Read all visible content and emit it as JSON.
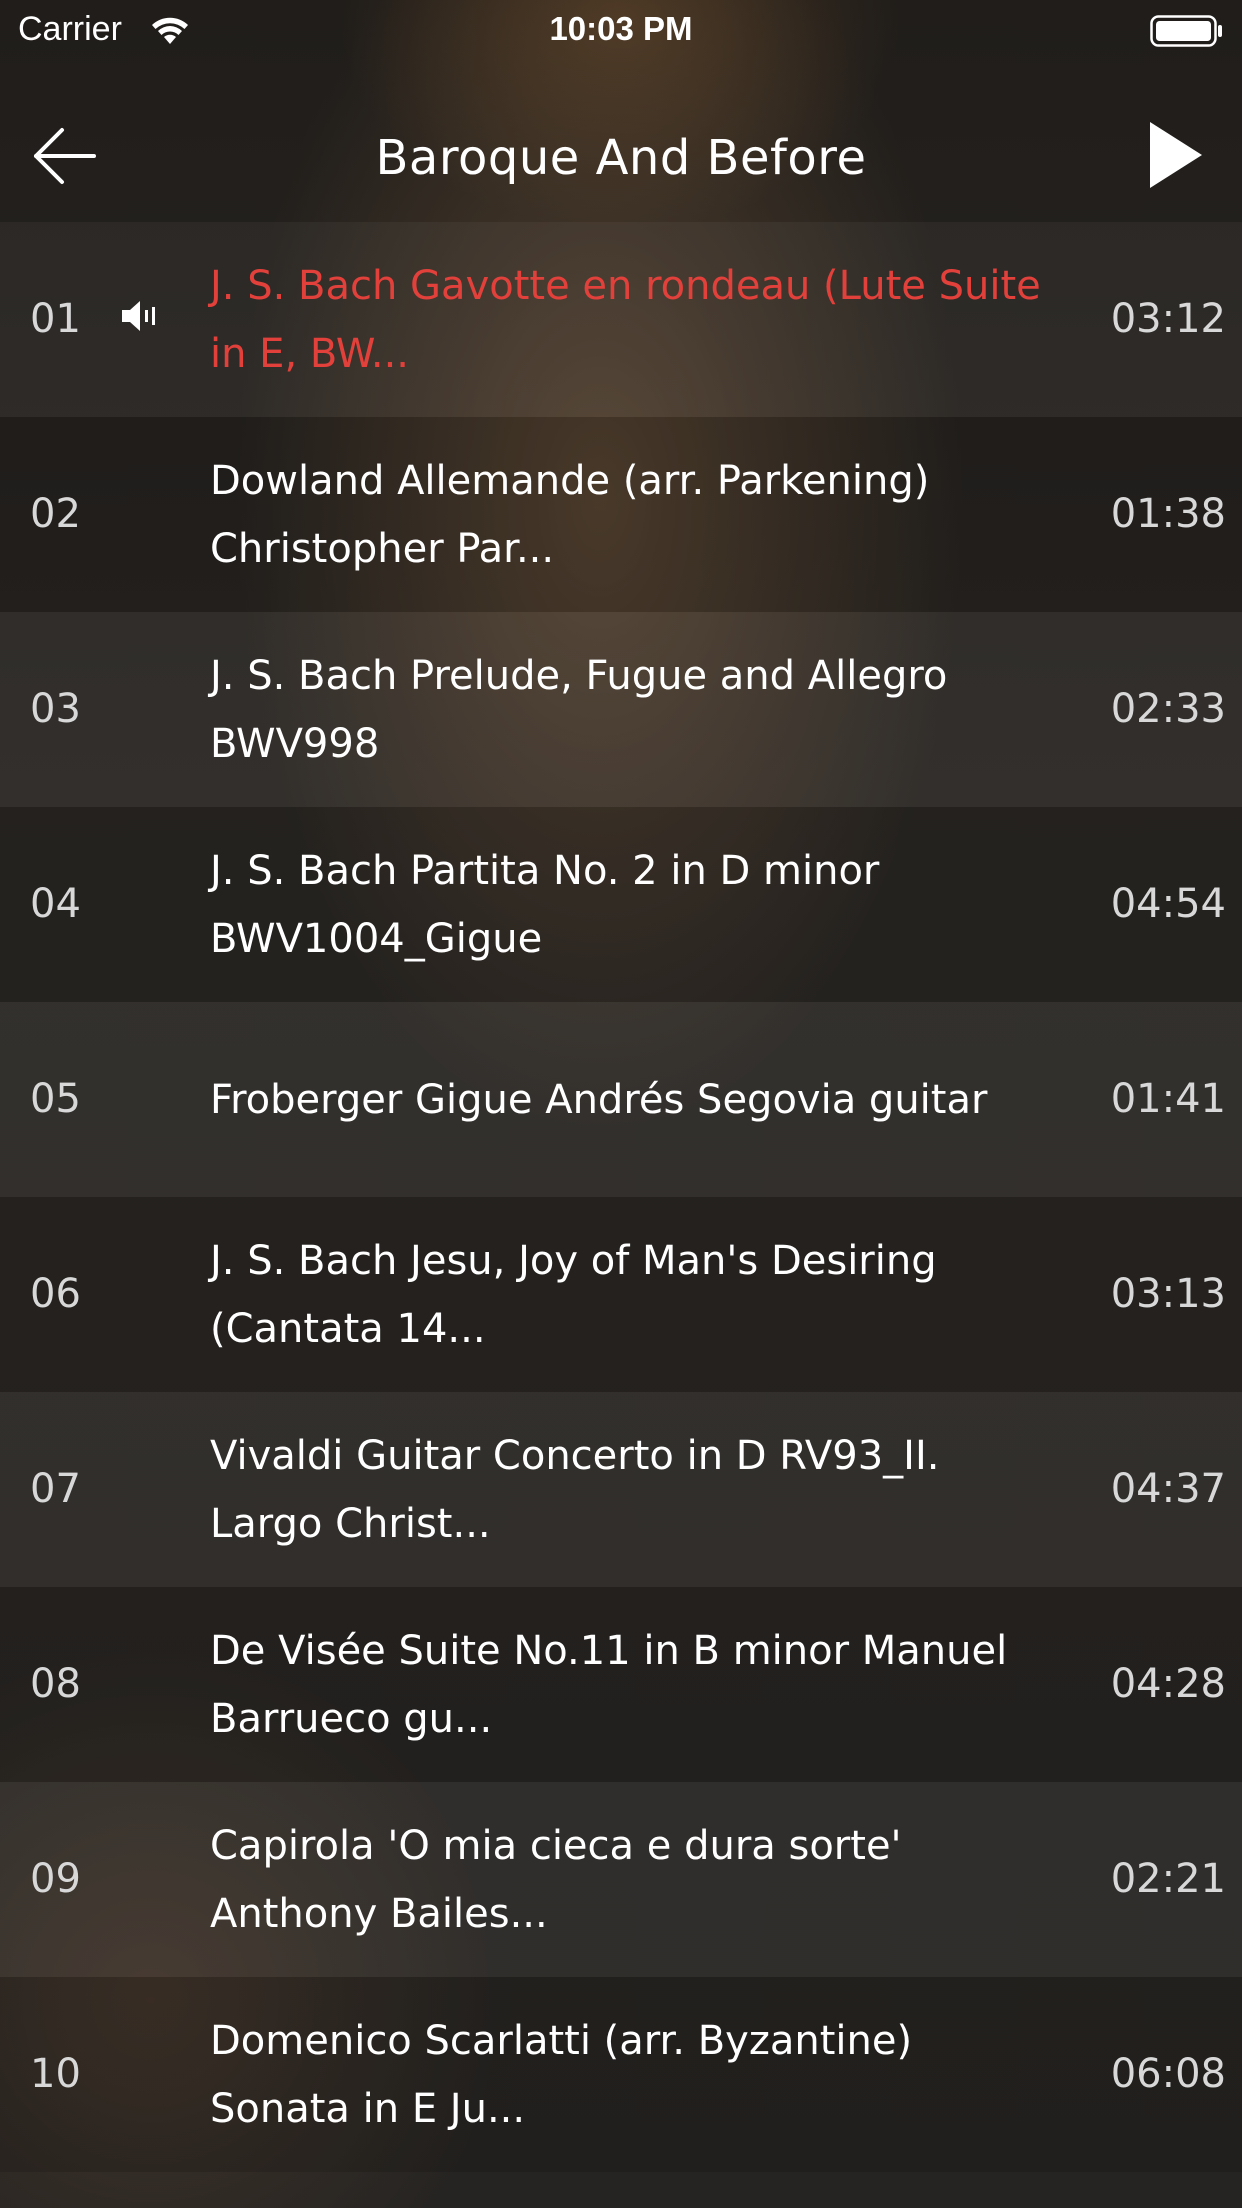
{
  "status_bar": {
    "carrier": "Carrier",
    "time": "10:03 PM"
  },
  "nav": {
    "title": "Baroque And Before"
  },
  "colors": {
    "active_track": "#e2403b",
    "text": "#ffffff",
    "secondary_text": "#d8d8d8"
  },
  "tracks": [
    {
      "num": "01",
      "title": "J. S. Bach Gavotte en rondeau (Lute Suite in E, BW...",
      "duration": "03:12",
      "playing": true
    },
    {
      "num": "02",
      "title": "Dowland Allemande (arr. Parkening) Christopher Par...",
      "duration": "01:38",
      "playing": false
    },
    {
      "num": "03",
      "title": "J. S. Bach Prelude, Fugue and Allegro BWV998",
      "duration": "02:33",
      "playing": false
    },
    {
      "num": "04",
      "title": "J. S. Bach Partita No. 2 in D minor BWV1004_Gigue",
      "duration": "04:54",
      "playing": false
    },
    {
      "num": "05",
      "title": "Froberger Gigue Andrés Segovia guitar",
      "duration": "01:41",
      "playing": false
    },
    {
      "num": "06",
      "title": "J. S. Bach Jesu, Joy of Man's Desiring (Cantata 14...",
      "duration": "03:13",
      "playing": false
    },
    {
      "num": "07",
      "title": "Vivaldi Guitar Concerto in D RV93_II. Largo Christ...",
      "duration": "04:37",
      "playing": false
    },
    {
      "num": "08",
      "title": "De Visée Suite No.11 in B minor Manuel Barrueco gu...",
      "duration": "04:28",
      "playing": false
    },
    {
      "num": "09",
      "title": "Capirola 'O mia cieca e dura sorte' Anthony Bailes...",
      "duration": "02:21",
      "playing": false
    },
    {
      "num": "10",
      "title": "Domenico Scarlatti (arr. Byzantine) Sonata in E Ju...",
      "duration": "06:08",
      "playing": false
    }
  ]
}
